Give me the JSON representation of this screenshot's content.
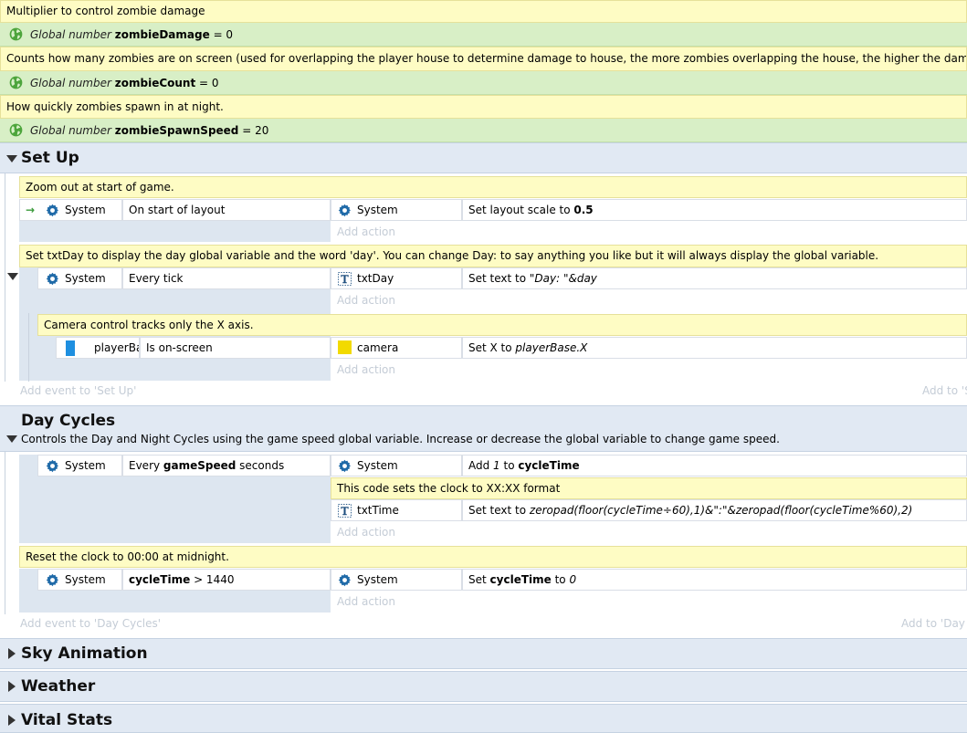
{
  "globals": [
    {
      "comment": "Multiplier to control zombie damage",
      "label": "Global number",
      "name": "zombieDamage",
      "value": "= 0"
    },
    {
      "comment": "Counts how many zombies are on screen (used for overlapping the player house to determine damage to house, the more zombies overlapping the house, the higher the damage rate)",
      "label": "Global number",
      "name": "zombieCount",
      "value": "= 0"
    },
    {
      "comment": "How quickly zombies spawn in at night.",
      "label": "Global number",
      "name": "zombieSpawnSpeed",
      "value": "= 20"
    }
  ],
  "setup": {
    "title": "Set Up",
    "comment1": "Zoom out at start of game.",
    "ev1": {
      "obj": "System",
      "cond": "On start of layout",
      "act_obj": "System",
      "act_pre": "Set layout scale to ",
      "act_val": "0.5"
    },
    "comment2": "Set txtDay to display the day global variable and the word 'day'. You can change Day: to say anything you like but it will always display the global variable.",
    "ev2": {
      "obj": "System",
      "cond": "Every tick",
      "act_obj": "txtDay",
      "act_pre": "Set text to ",
      "act_val": "\"Day: \"&day"
    },
    "comment3": "Camera control tracks only the X axis.",
    "ev3": {
      "obj": "playerBa...",
      "cond": "Is on-screen",
      "act_obj": "camera",
      "act_pre": "Set X to ",
      "act_val": "playerBase.X"
    },
    "add_event": "Add event to 'Set Up'",
    "add_to": "Add to 'S"
  },
  "daycycles": {
    "title": "Day Cycles",
    "desc": "Controls the Day and Night Cycles using the game speed global variable. Increase or decrease the global variable to change game speed.",
    "ev1": {
      "obj": "System",
      "cond_pre": "Every ",
      "cond_b": "gameSpeed",
      "cond_post": " seconds",
      "act_obj": "System",
      "act_pre": "Add ",
      "act_i": "1",
      "act_mid": " to ",
      "act_b": "cycleTime"
    },
    "inner_comment": "This code sets the clock to XX:XX format",
    "act2": {
      "obj": "txtTime",
      "pre": "Set text to ",
      "val": "zeropad(floor(cycleTime÷60),1)&\":\"&zeropad(floor(cycleTime%60),2)"
    },
    "comment2": "Reset the clock to 00:00 at midnight.",
    "ev2": {
      "obj": "System",
      "cond_b": "cycleTime",
      "cond_post": " > 1440",
      "act_obj": "System",
      "act_pre": "Set ",
      "act_b": "cycleTime",
      "act_mid": " to ",
      "act_i": "0"
    },
    "add_event": "Add event to 'Day Cycles'",
    "add_to": "Add to 'Day"
  },
  "add_action": "Add action",
  "collapsed_groups": [
    "Sky Animation",
    "Weather",
    "Vital Stats"
  ],
  "colors": {
    "comment": "#fefcc4",
    "global": "#d8efc6",
    "group": "#e1e9f3",
    "event_bg": "#dde6f0"
  }
}
